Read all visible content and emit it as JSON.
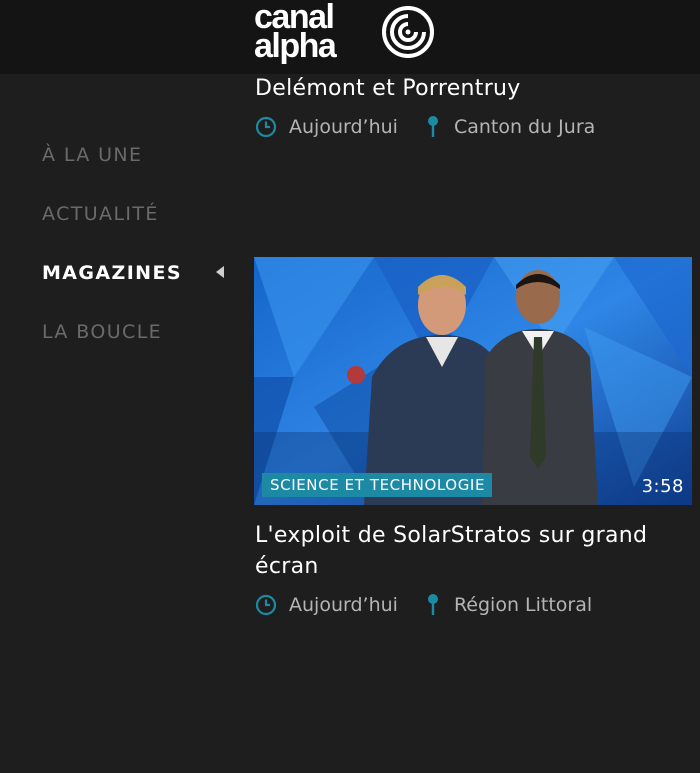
{
  "header": {
    "logo": {
      "line1": "canal",
      "line2": "alpha"
    }
  },
  "nav": {
    "items": [
      {
        "label": "À LA UNE"
      },
      {
        "label": "ACTUALITÉ"
      },
      {
        "label": "MAGAZINES"
      },
      {
        "label": "LA BOUCLE"
      }
    ]
  },
  "articles": [
    {
      "title": "Delémont et Porrentruy",
      "time": "Aujourd’hui",
      "location": "Canton du Jura"
    },
    {
      "title": "L'exploit de SolarStratos sur grand écran",
      "time": "Aujourd’hui",
      "location": "Région Littoral",
      "category": "SCIENCE ET TECHNOLOGIE",
      "duration": "3:58"
    }
  ],
  "colors": {
    "accent": "#1d8aa5",
    "background": "#1e1e1e",
    "header": "#141414",
    "nav_inactive": "#6a6a6a",
    "meta_text": "#b4b4b4"
  }
}
